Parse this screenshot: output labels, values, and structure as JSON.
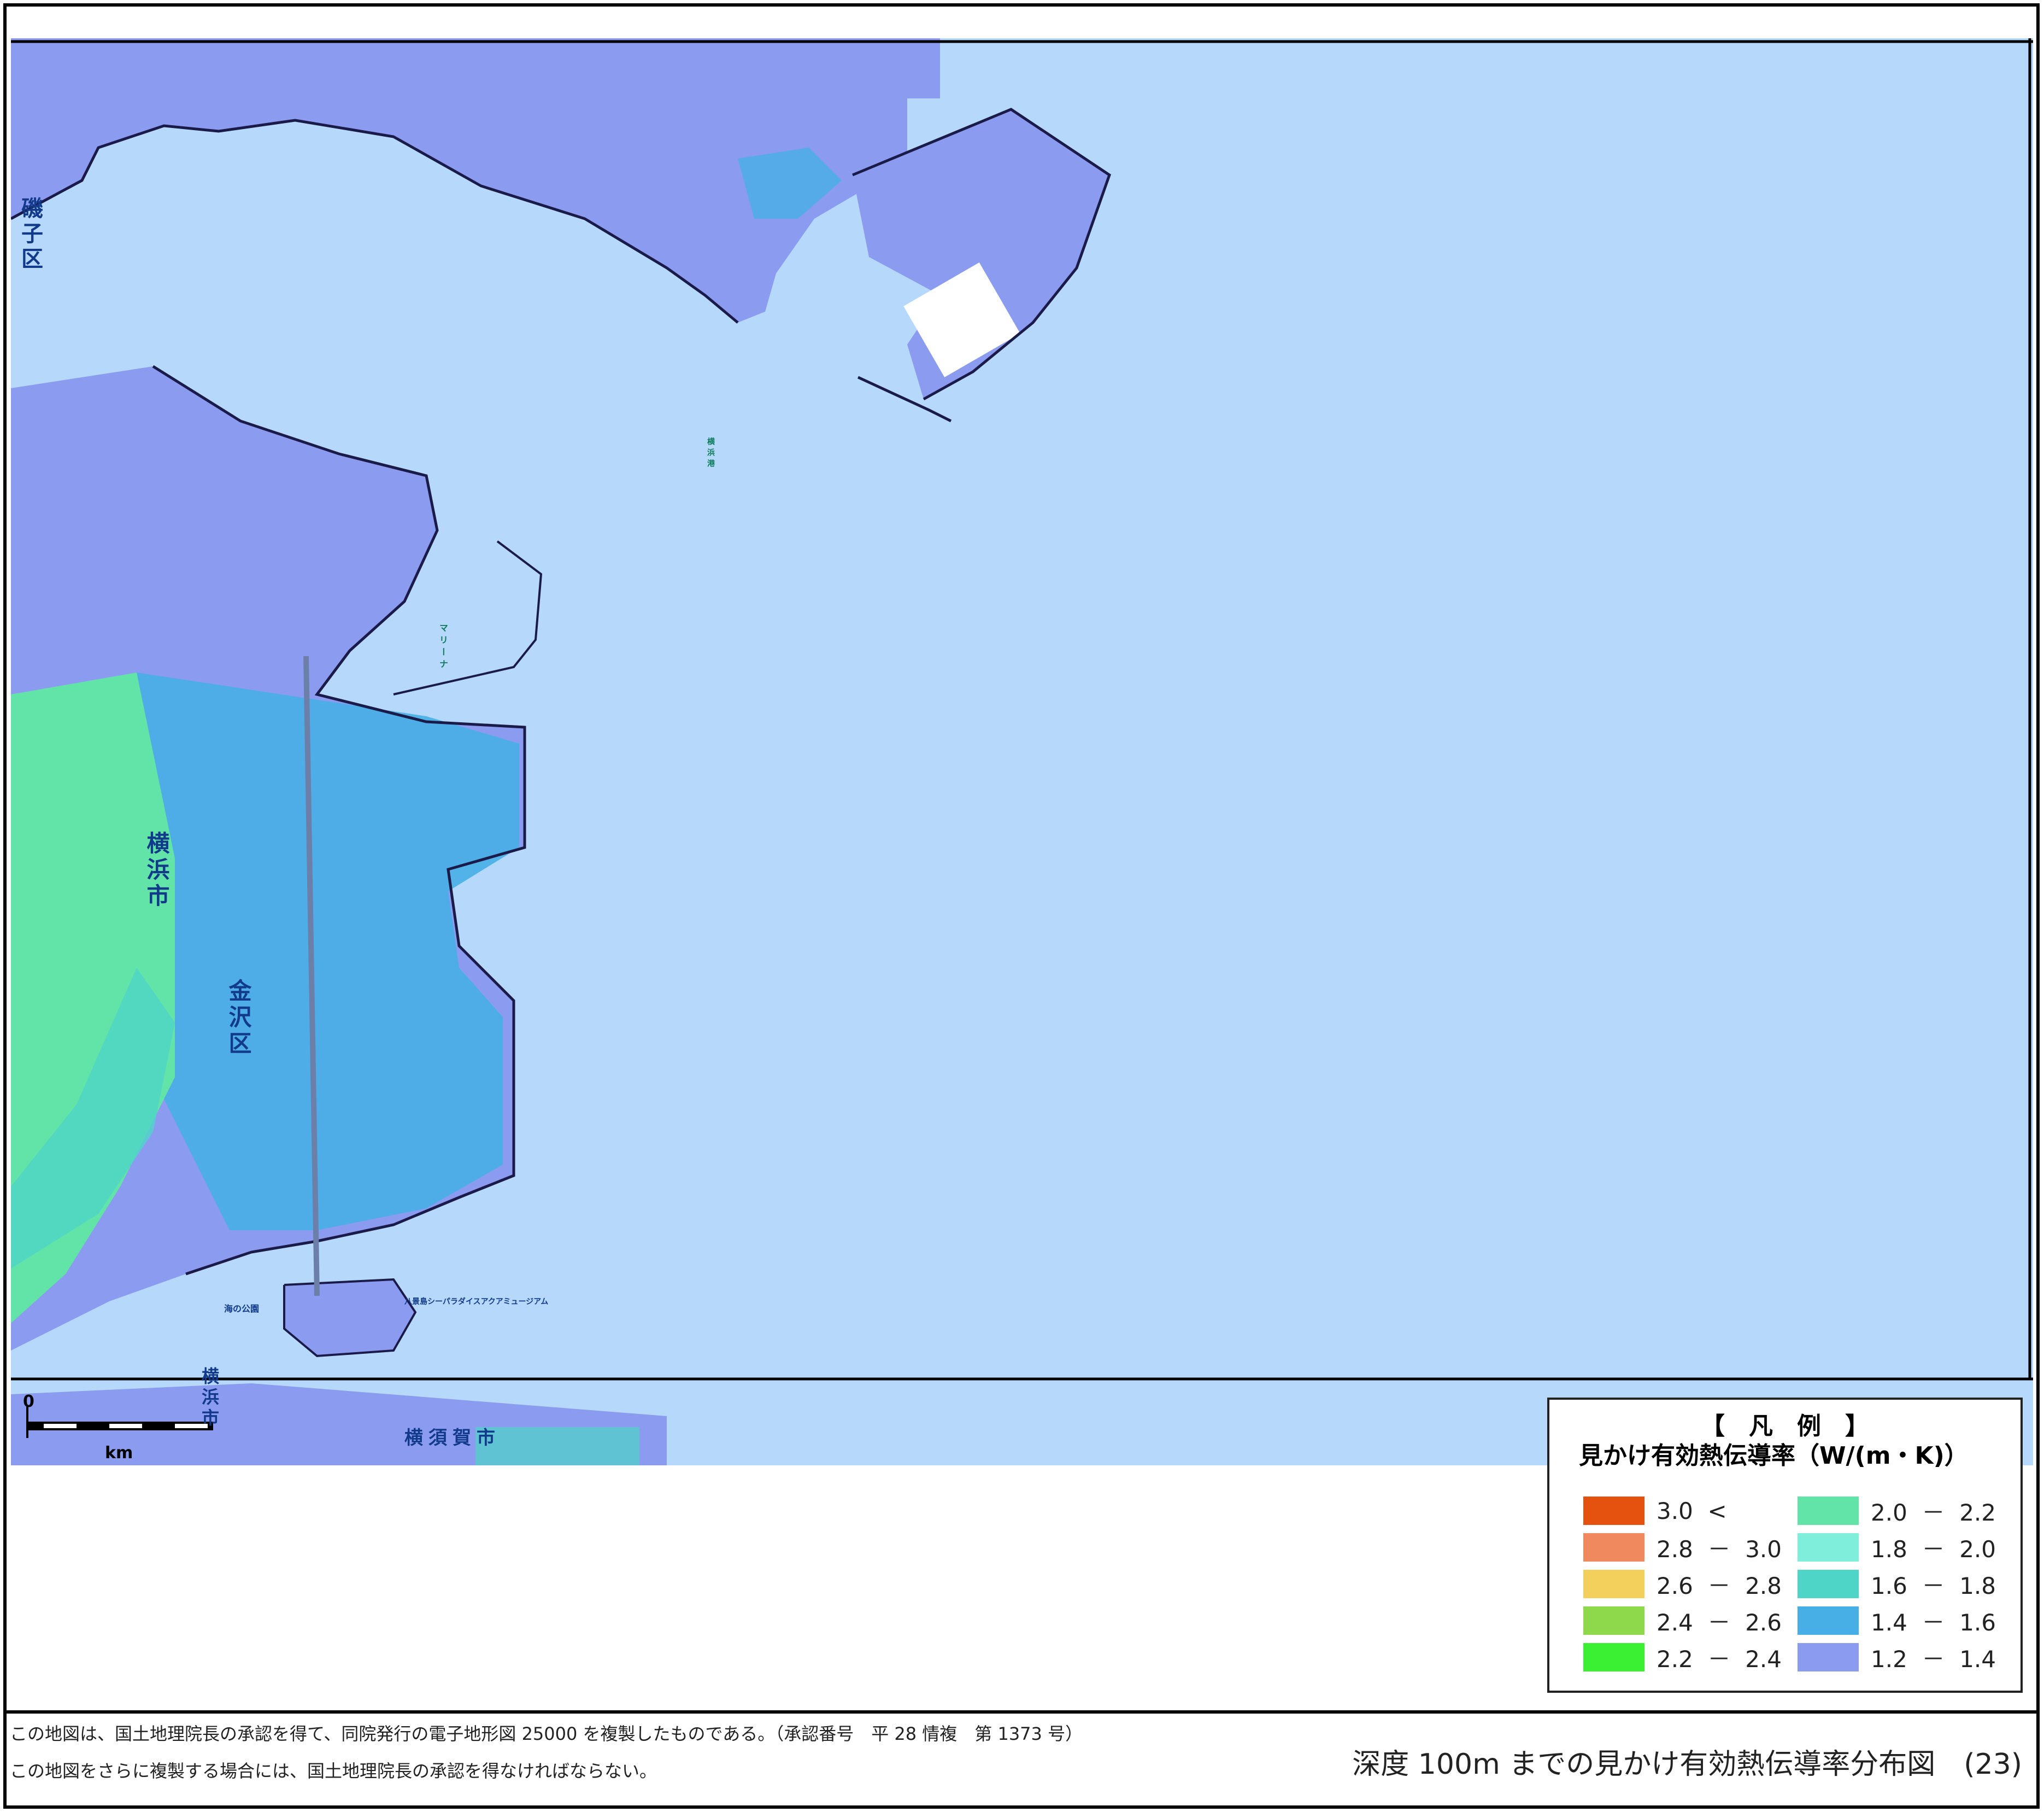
{
  "map": {
    "labels": {
      "ward_isogo": "磯子区",
      "ward_kanazawa": "金沢区",
      "city_yokohama": "横浜市",
      "city_yokosuka": "横須賀市",
      "city_yokohama_small": "横浜市",
      "port_yokohama": "横浜港",
      "port_hakkeijima": "八景島シーパラダイスアクアミュージアム",
      "marina": "マリーナ",
      "umi_no_koen": "海の公園"
    },
    "scale_bar": {
      "zero_label": "0",
      "unit_label": "km"
    }
  },
  "legend": {
    "title": "【　凡　例　】",
    "subtitle": "見かけ有効熱伝導率（W/(m・K)）",
    "items": [
      {
        "label": "3.0  <",
        "color": "#e5520f"
      },
      {
        "label": "2.8  －  3.0",
        "color": "#f08a5e"
      },
      {
        "label": "2.6  －  2.8",
        "color": "#f3cf5c"
      },
      {
        "label": "2.4  －  2.6",
        "color": "#8ed84c"
      },
      {
        "label": "2.2  －  2.4",
        "color": "#3bf033"
      },
      {
        "label": "2.0  －  2.2",
        "color": "#62e3a7"
      },
      {
        "label": "1.8  －  2.0",
        "color": "#7feeda"
      },
      {
        "label": "1.6  －  1.8",
        "color": "#4fd4c8"
      },
      {
        "label": "1.4  －  1.6",
        "color": "#47aee6"
      },
      {
        "label": "1.2  －  1.4",
        "color": "#8b9cf0"
      }
    ]
  },
  "footer": {
    "credit_line1": "この地図は、国土地理院長の承認を得て、同院発行の電子地形図 25000 を複製したものである。（承認番号　平 28 情複　第 1373 号）",
    "credit_line2": "この地図をさらに複製する場合には、国土地理院長の承認を得なければならない。",
    "title": "深度 100m までの見かけ有効熱伝導率分布図　(23)"
  },
  "colors": {
    "sea": "#b6d9fb",
    "land_low": "#8b9cf0",
    "land_mid": "#47aee6",
    "land_green": "#62e3a7"
  }
}
